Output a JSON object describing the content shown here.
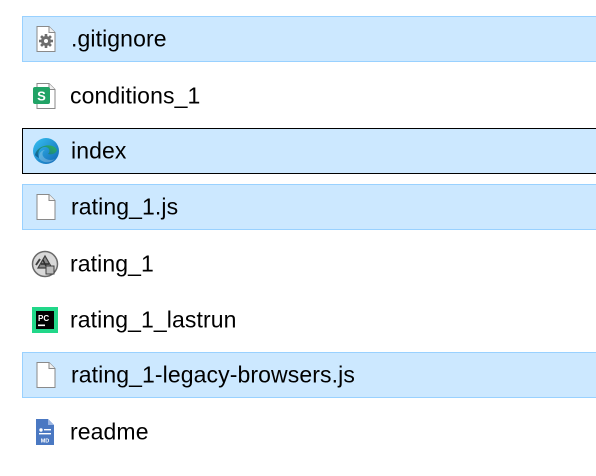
{
  "files": [
    {
      "name": ".gitignore",
      "icon": "settings-file-icon",
      "state": "selected"
    },
    {
      "name": "conditions_1",
      "icon": "spreadsheet-icon",
      "state": "normal"
    },
    {
      "name": "index",
      "icon": "edge-browser-icon",
      "state": "focused"
    },
    {
      "name": "rating_1.js",
      "icon": "blank-file-icon",
      "state": "selected"
    },
    {
      "name": "rating_1",
      "icon": "psychopy-icon",
      "state": "normal"
    },
    {
      "name": "rating_1_lastrun",
      "icon": "pycharm-icon",
      "state": "normal"
    },
    {
      "name": "rating_1-legacy-browsers.js",
      "icon": "blank-file-icon",
      "state": "selected"
    },
    {
      "name": "readme",
      "icon": "markdown-file-icon",
      "state": "normal"
    }
  ],
  "colors": {
    "selection_bg": "#cce8ff",
    "selection_border": "#99d1ff",
    "focus_border": "#000000",
    "spreadsheet_green": "#21a366",
    "pycharm_green": "#21d789",
    "markdown_blue": "#4a78c2"
  }
}
